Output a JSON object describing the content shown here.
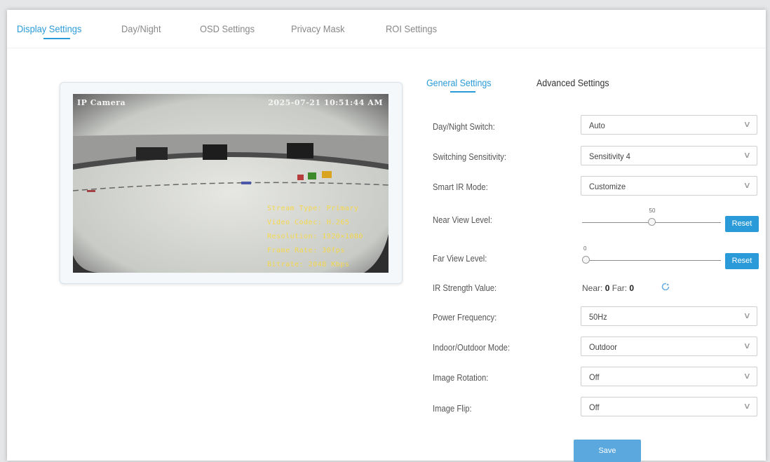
{
  "tabs": [
    "Display Settings",
    "Day/Night",
    "OSD Settings",
    "Privacy Mask",
    "ROI Settings"
  ],
  "sub_tabs": [
    "General Settings",
    "Advanced Settings"
  ],
  "video": {
    "camera_name": "IP Camera",
    "timestamp": "2025-07-21 10:51:44 AM",
    "stream_info": [
      "Stream Type: Primary",
      "Video Codec: H.265",
      "Resolution: 1920×1080",
      "Frame Rate: 30fps",
      "Bitrate: 2048 Kbps"
    ]
  },
  "settings": {
    "day_night_switch": {
      "label": "Day/Night Switch:",
      "value": "Auto"
    },
    "switching_sensitivity": {
      "label": "Switching Sensitivity:",
      "value": "Sensitivity 4"
    },
    "smart_ir_mode": {
      "label": "Smart IR Mode:",
      "value": "Customize"
    },
    "near_view_level": {
      "label": "Near View Level:",
      "value": 50
    },
    "far_view_level": {
      "label": "Far View Level:",
      "value": 0
    },
    "ir_strength": {
      "label": "IR Strength Value:",
      "near_label": "Near:",
      "near": "0",
      "far_label": "Far:",
      "far": "0"
    },
    "power_frequency": {
      "label": "Power Frequency:",
      "value": "50Hz"
    },
    "indoor_outdoor_mode": {
      "label": "Indoor/Outdoor Mode:",
      "value": "Outdoor"
    },
    "image_rotation": {
      "label": "Image Rotation:",
      "value": "Off"
    },
    "image_flip": {
      "label": "Image Flip:",
      "value": "Off"
    }
  },
  "buttons": {
    "reset": "Reset",
    "save": "Save"
  },
  "colors": {
    "accent": "#2a9ad8",
    "osd_text": "#f4d84b"
  }
}
